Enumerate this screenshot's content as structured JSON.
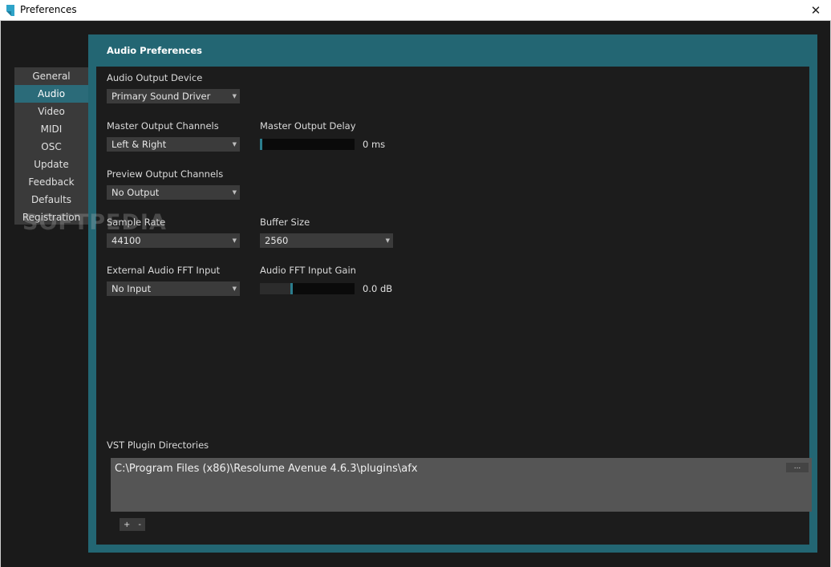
{
  "window": {
    "title": "Preferences"
  },
  "nav": {
    "items": [
      {
        "label": "General"
      },
      {
        "label": "Audio",
        "active": true
      },
      {
        "label": "Video"
      },
      {
        "label": "MIDI"
      },
      {
        "label": "OSC"
      },
      {
        "label": "Update"
      },
      {
        "label": "Feedback"
      },
      {
        "label": "Defaults"
      },
      {
        "label": "Registration"
      }
    ]
  },
  "panel": {
    "title": "Audio Preferences",
    "output_device": {
      "label": "Audio Output Device",
      "value": "Primary Sound Driver"
    },
    "master_channels": {
      "label": "Master Output Channels",
      "value": "Left & Right"
    },
    "master_delay": {
      "label": "Master Output Delay",
      "value_text": "0 ms",
      "level": 0.0
    },
    "preview_channels": {
      "label": "Preview Output Channels",
      "value": "No Output"
    },
    "sample_rate": {
      "label": "Sample Rate",
      "value": "44100"
    },
    "buffer_size": {
      "label": "Buffer Size",
      "value": "2560"
    },
    "fft_input": {
      "label": "External Audio FFT Input",
      "value": "No Input"
    },
    "fft_gain": {
      "label": "Audio FFT Input Gain",
      "value_text": "0.0 dB",
      "level": 0.33
    },
    "vst": {
      "label": "VST Plugin Directories",
      "paths": [
        "C:\\Program Files (x86)\\Resolume Avenue 4.6.3\\plugins\\afx"
      ],
      "browse_label": "...",
      "add_label": "+",
      "remove_label": "-"
    }
  },
  "watermark": "SOFTPEDIA",
  "colors": {
    "accent": "#236673",
    "nav_active": "#2b6b79",
    "slider_handle": "#2b7d8d"
  }
}
